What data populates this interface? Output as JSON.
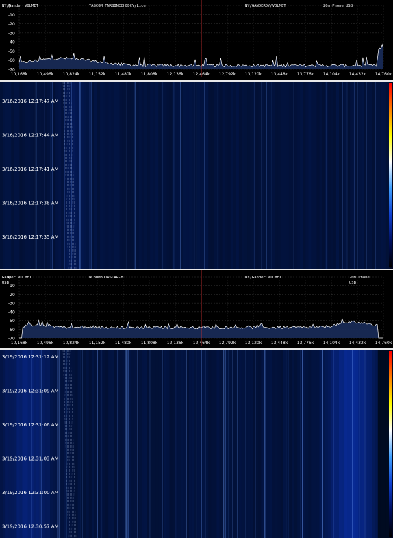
{
  "chart_data": [
    {
      "type": "line",
      "x_tick_labels": [
        "10,168k",
        "10,496k",
        "10,824k",
        "11,152k",
        "11,480k",
        "11,808k",
        "12,136k",
        "12,464k",
        "12,792k",
        "13,120k",
        "13,448k",
        "13,776k",
        "14,104k",
        "14,432k",
        "14,760k"
      ],
      "y_tick_labels": [
        "0",
        "-10",
        "-20",
        "-30",
        "-40",
        "-50",
        "-60",
        "-70"
      ],
      "ylim": [
        -70,
        0
      ],
      "grid": true,
      "center_marker_freq": "12,464k",
      "noise_floor_dbm": -66,
      "annotations": [
        {
          "text": "TASCOM FNRBINECHEDCY/Lice",
          "freq": "11,152k"
        },
        {
          "text": "NY/GANDERDY/VOLMET",
          "freq": "13,120k"
        },
        {
          "text": "20m Phone USB",
          "freq": "14,104k"
        },
        {
          "text": "NY/Gander VOLMET",
          "freq": "10,168k"
        }
      ],
      "colors": {
        "trace": "#ffffff",
        "fill": "#1a2c5a",
        "marker": "#d03030",
        "grid": "#3a3a3a"
      }
    },
    {
      "type": "heatmap",
      "date": "3/16/2016",
      "timestamps": [
        "3/16/2016 12:17:47 AM",
        "3/16/2016 12:17:44 AM",
        "3/16/2016 12:17:41 AM",
        "3/16/2016 12:17:38 AM",
        "3/16/2016 12:17:35 AM"
      ],
      "colormap": [
        "#000000",
        "#001060",
        "#1040d0",
        "#40a0ff",
        "#ffffff",
        "#ffff00",
        "#ff8000",
        "#ff0000"
      ]
    },
    {
      "type": "line",
      "x_tick_labels": [
        "10,168k",
        "10,496k",
        "10,824k",
        "11,152k",
        "11,480k",
        "11,808k",
        "12,136k",
        "12,464k",
        "12,792k",
        "13,120k",
        "13,448k",
        "13,776k",
        "14,104k",
        "14,432k",
        "14,760k"
      ],
      "y_tick_labels": [
        "0",
        "-10",
        "-20",
        "-30",
        "-40",
        "-50",
        "-60",
        "-70"
      ],
      "ylim": [
        -70,
        0
      ],
      "grid": true,
      "center_marker_freq": "12,464k",
      "noise_floor_dbm": -58,
      "annotations": [
        {
          "text": "Gander VOLMET",
          "freq": "10,168k"
        },
        {
          "text": "USB",
          "freq": "10,168k"
        },
        {
          "text": "WCBDMBDDRSCAR-B",
          "freq": "11,152k"
        },
        {
          "text": "NY/Gander VOLMET",
          "freq": "13,120k"
        },
        {
          "text": "20m Phone",
          "freq": "14,432k"
        },
        {
          "text": "USB",
          "freq": "14,432k"
        }
      ],
      "colors": {
        "trace": "#ffffff",
        "fill": "#1a2c5a",
        "marker": "#d03030",
        "grid": "#3a3a3a"
      }
    },
    {
      "type": "heatmap",
      "date": "3/19/2016",
      "timestamps": [
        "3/19/2016 12:31:12 AM",
        "3/19/2016 12:31:09 AM",
        "3/19/2016 12:31:06 AM",
        "3/19/2016 12:31:03 AM",
        "3/19/2016 12:31:00 AM",
        "3/19/2016 12:30:57 AM"
      ],
      "colormap": [
        "#000000",
        "#001060",
        "#1040d0",
        "#40a0ff",
        "#ffffff",
        "#ffff00",
        "#ff8000",
        "#ff0000"
      ]
    }
  ]
}
